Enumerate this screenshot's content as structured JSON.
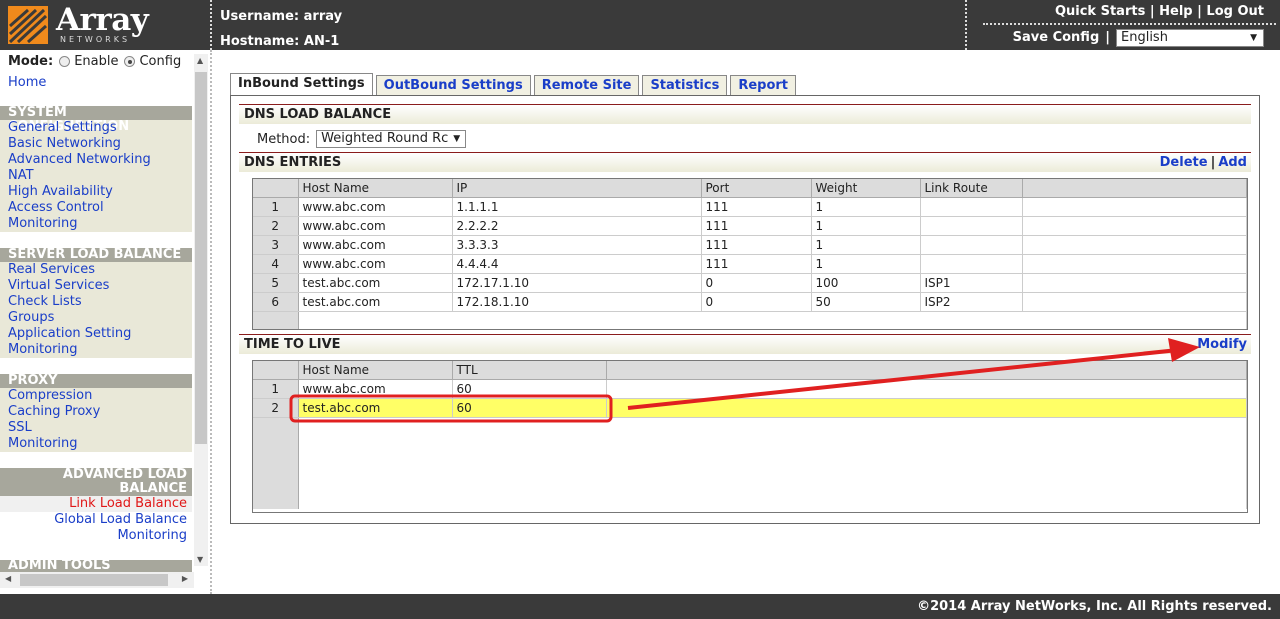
{
  "header": {
    "logo_text": "Array",
    "logo_sub": "NETWORKS",
    "username_label": "Username:",
    "username": "array",
    "hostname_label": "Hostname:",
    "hostname": "AN-1",
    "quick_starts": "Quick Starts",
    "help": "Help",
    "logout": "Log Out",
    "save_config": "Save Config",
    "separator": "|",
    "language": "English"
  },
  "sidebar": {
    "mode_label": "Mode:",
    "mode_enable": "Enable",
    "mode_config": "Config",
    "mode_selected": "Config",
    "home": "Home",
    "sections": [
      {
        "title": "SYSTEM CONFIGURATION",
        "items": [
          "General Settings",
          "Basic Networking",
          "Advanced Networking",
          "NAT",
          "High Availability",
          "Access Control",
          "Monitoring"
        ]
      },
      {
        "title": "SERVER LOAD BALANCE",
        "items": [
          "Real Services",
          "Virtual Services",
          "Check Lists",
          "Groups",
          "Application Setting",
          "Monitoring"
        ]
      },
      {
        "title": "PROXY",
        "items": [
          "Compression",
          "Caching Proxy",
          "SSL",
          "Monitoring"
        ]
      }
    ],
    "advanced": {
      "title_line1": "ADVANCED LOAD",
      "title_line2": "BALANCE",
      "items": [
        "Link Load Balance",
        "Global Load Balance",
        "Monitoring"
      ],
      "active": "Link Load Balance"
    },
    "admin_title": "ADMIN TOOLS"
  },
  "tabs": [
    "InBound Settings",
    "OutBound Settings",
    "Remote Site",
    "Statistics",
    "Report"
  ],
  "active_tab": "InBound Settings",
  "dns_lb": {
    "title": "DNS LOAD BALANCE",
    "method_label": "Method:",
    "method_value": "Weighted Round Rc"
  },
  "dns_entries": {
    "title": "DNS ENTRIES",
    "delete": "Delete",
    "add": "Add",
    "columns": [
      "Host Name",
      "IP",
      "Port",
      "Weight",
      "Link Route"
    ],
    "rows": [
      [
        "1",
        "www.abc.com",
        "1.1.1.1",
        "111",
        "1",
        ""
      ],
      [
        "2",
        "www.abc.com",
        "2.2.2.2",
        "111",
        "1",
        ""
      ],
      [
        "3",
        "www.abc.com",
        "3.3.3.3",
        "111",
        "1",
        ""
      ],
      [
        "4",
        "www.abc.com",
        "4.4.4.4",
        "111",
        "1",
        ""
      ],
      [
        "5",
        "test.abc.com",
        "172.17.1.10",
        "0",
        "100",
        "ISP1"
      ],
      [
        "6",
        "test.abc.com",
        "172.18.1.10",
        "0",
        "50",
        "ISP2"
      ]
    ]
  },
  "ttl": {
    "title": "TIME TO LIVE",
    "modify": "Modify",
    "columns": [
      "Host Name",
      "TTL"
    ],
    "rows": [
      [
        "1",
        "www.abc.com",
        "60"
      ],
      [
        "2",
        "test.abc.com",
        "60"
      ]
    ],
    "highlighted_row": 2
  },
  "footer": "©2014 Array NetWorks, Inc. All Rights reserved.",
  "colors": {
    "link": "#1a3ec8",
    "active_nav": "#e01818",
    "highlight": "#ffff66",
    "annotation": "#e02020",
    "header_bg": "#3a3a3a"
  }
}
